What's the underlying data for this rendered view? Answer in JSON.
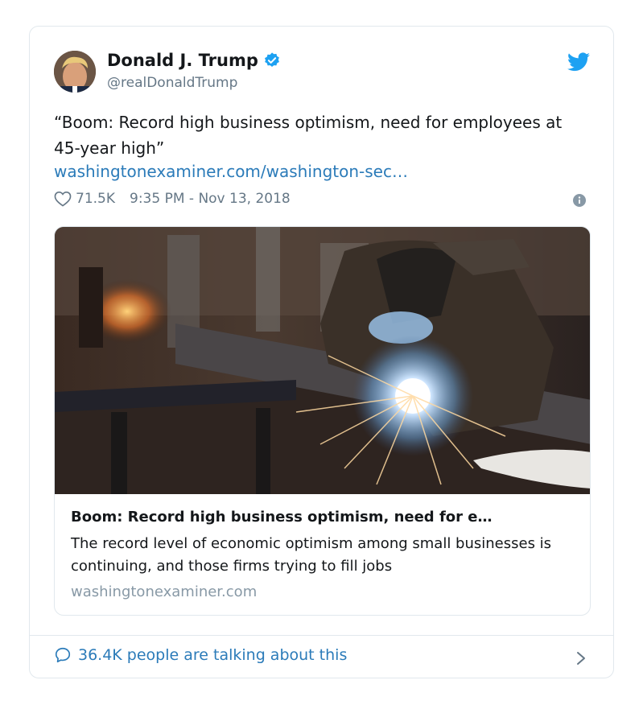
{
  "tweet": {
    "author_name": "Donald J. Trump",
    "author_handle": "@realDonaldTrump",
    "text": "“Boom: Record high business optimism, need for employees at 45-year high”",
    "link_text": "washingtonexaminer.com/washington-sec…",
    "likes": "71.5K",
    "timestamp": "9:35 PM - Nov 13, 2018"
  },
  "link_card": {
    "title": "Boom: Record high business optimism, need for e…",
    "description": "The record level of economic optimism among small businesses is continuing, and those firms trying to fill jobs",
    "domain": "washingtonexaminer.com"
  },
  "footer": {
    "talking_text": "36.4K people are talking about this"
  },
  "icons": {
    "verified": "verified-badge-icon",
    "twitter": "twitter-bird-icon",
    "like": "heart-icon",
    "info": "info-icon",
    "reply": "speech-bubble-icon",
    "chevron": "chevron-right-icon"
  },
  "colors": {
    "accent": "#1da1f2",
    "link": "#2b7bb9",
    "muted": "#657786",
    "border": "#e1e8ed"
  }
}
